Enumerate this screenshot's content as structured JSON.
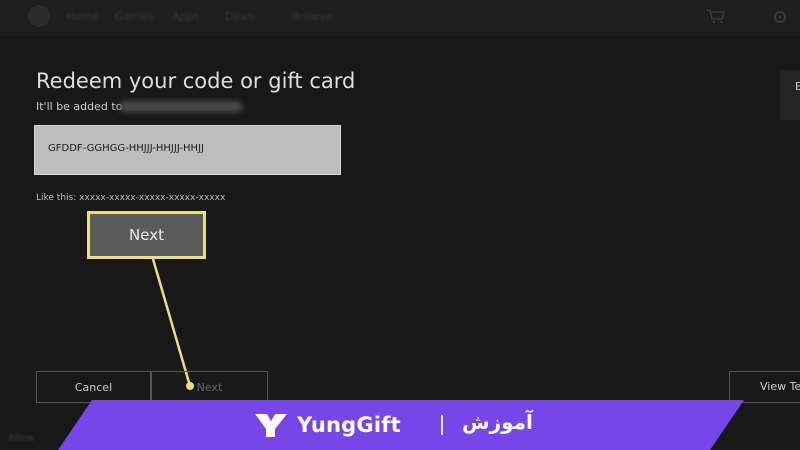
{
  "topbar": {
    "nav_items": [
      "Home",
      "Games",
      "Apps",
      "Deals",
      "Browse"
    ]
  },
  "redeem": {
    "title": "Redeem your code or gift card",
    "subtitle": "It'll be added to",
    "code_value": "GFDDF-GGHGG-HHJJJ-HHJJJ-HHJJ",
    "hint": "Like this: xxxxx-xxxxx-xxxxx-xxxxx-xxxxx",
    "next_highlight_label": "Next"
  },
  "footer": {
    "cancel_label": "Cancel",
    "next_label": "Next",
    "view_label": "View Ter",
    "right_edge_text": "E",
    "bottom_hint": "Allow"
  },
  "banner": {
    "brand": "YungGift",
    "label": "آموزش"
  },
  "colors": {
    "banner": "#7646e8",
    "highlight": "#e8e07a",
    "background": "#181818"
  }
}
